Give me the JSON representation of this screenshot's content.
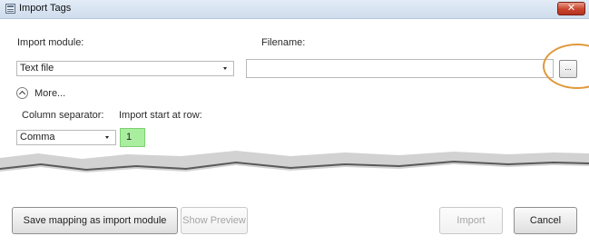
{
  "window": {
    "title": "Import Tags",
    "close_label": "✕"
  },
  "form": {
    "import_module_label": "Import module:",
    "import_module_value": "Text file",
    "filename_label": "Filename:",
    "filename_value": "",
    "browse_label": "...",
    "more_label": "More...",
    "column_separator_label": "Column separator:",
    "column_separator_value": "Comma",
    "import_start_label": "Import start at row:",
    "import_start_value": "1"
  },
  "buttons": {
    "save_mapping": "Save mapping as import module",
    "show_preview": "Show Preview",
    "import": "Import",
    "cancel": "Cancel"
  },
  "colors": {
    "highlight_circle": "#e09a3b",
    "start_row_field": "#a9ee9e",
    "close_button": "#c8432d"
  }
}
